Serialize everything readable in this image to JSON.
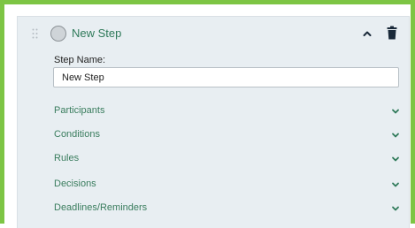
{
  "step": {
    "title": "New Step",
    "name_label": "Step Name:",
    "name_value": "New Step"
  },
  "sections": [
    {
      "label": "Participants"
    },
    {
      "label": "Conditions"
    },
    {
      "label": "Rules"
    },
    {
      "label": "Decisions"
    },
    {
      "label": "Deadlines/Reminders"
    }
  ],
  "icons": {
    "drag": "drag-handle-icon",
    "status": "step-status-circle-icon",
    "collapse": "chevron-up-icon",
    "delete": "trash-icon",
    "expand": "chevron-down-icon"
  },
  "colors": {
    "highlight_border": "#7dc544",
    "card_background": "#e8eef2",
    "title_text": "#2f7a5a",
    "section_text": "#3a7d5e",
    "chevron": "#2f7a5a",
    "delete_icon": "#1a2a3a"
  }
}
